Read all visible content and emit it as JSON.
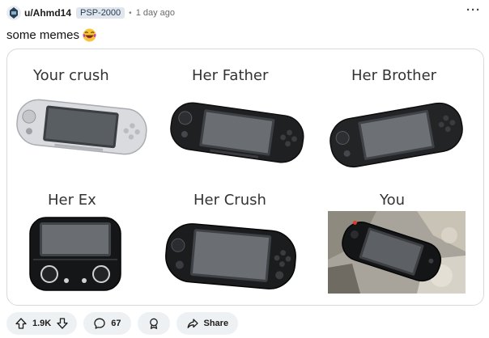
{
  "post": {
    "username": "u/Ahmd14",
    "flair": "PSP-2000",
    "separator": "•",
    "time": "1 day ago",
    "more": "···",
    "title": "some memes"
  },
  "meme": {
    "cells": [
      {
        "label": "Your crush",
        "model": "PSP-2000 silver"
      },
      {
        "label": "Her Father",
        "model": "PSP-1000 black"
      },
      {
        "label": "Her Brother",
        "model": "PSP-3000 black"
      },
      {
        "label": "Her Ex",
        "model": "PSP Go"
      },
      {
        "label": "Her Crush",
        "model": "PS Vita"
      },
      {
        "label": "You",
        "model": "PSP-E1000 photo"
      }
    ]
  },
  "actions": {
    "upvotes": "1.9K",
    "comments": "67",
    "share_label": "Share"
  },
  "colors": {
    "pill_bg": "#eef1f3",
    "flair_bg": "#dfe6ed",
    "text": "#1c1c1c",
    "meta": "#6a6a6a"
  }
}
